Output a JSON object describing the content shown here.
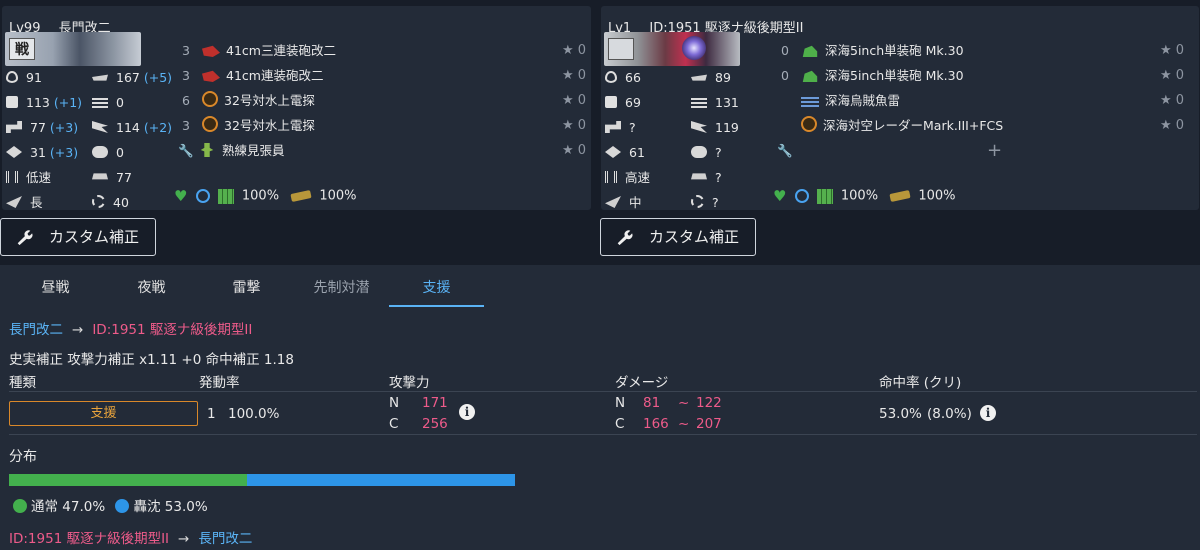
{
  "left_ship": {
    "level": "Lv99",
    "name": "長門改二",
    "type_badge": "戦",
    "stats": {
      "hp": "91",
      "speed_val": "167",
      "speed_bonus": "(+5)",
      "firepower": "113",
      "firepower_bonus": "(+1)",
      "asw": "0",
      "torpedo": "77",
      "torpedo_bonus": "(+3)",
      "aa": "114",
      "aa_bonus": "(+2)",
      "armor": "31",
      "armor_bonus": "(+3)",
      "evasion_misc": "0",
      "speed": "低速",
      "los": "77",
      "range": "長",
      "luck": "40"
    },
    "equipment": [
      {
        "slot": "3",
        "name": "41cm三連装砲改二",
        "icon": "main-gun-red",
        "star": "0"
      },
      {
        "slot": "3",
        "name": "41cm連装砲改二",
        "icon": "main-gun-red",
        "star": "0"
      },
      {
        "slot": "6",
        "name": "32号対水上電探",
        "icon": "radar",
        "star": "0"
      },
      {
        "slot": "3",
        "name": "32号対水上電探",
        "icon": "radar",
        "star": "0"
      },
      {
        "slot": "",
        "name": "熟練見張員",
        "icon": "lookout",
        "star": "0"
      }
    ],
    "morale": "100%",
    "ammo": "100%"
  },
  "right_ship": {
    "level": "Lv1",
    "name": "ID:1951 駆逐ナ級後期型II",
    "type_badge": "",
    "stats": {
      "hp": "66",
      "speed_val": "89",
      "firepower": "69",
      "asw": "131",
      "torpedo": "?",
      "aa": "119",
      "armor": "61",
      "evasion_misc": "?",
      "speed": "高速",
      "los": "?",
      "range": "中",
      "luck": "?"
    },
    "equipment": [
      {
        "slot": "0",
        "name": "深海5inch単装砲 Mk.30",
        "icon": "gun-green",
        "star": "0"
      },
      {
        "slot": "0",
        "name": "深海5inch単装砲 Mk.30",
        "icon": "gun-green",
        "star": "0"
      },
      {
        "slot": "",
        "name": "深海烏賊魚雷",
        "icon": "torpedo",
        "star": "0"
      },
      {
        "slot": "",
        "name": "深海対空レーダーMark.III+FCS",
        "icon": "radar",
        "star": "0"
      }
    ],
    "add_symbol": "+",
    "morale": "100%",
    "ammo": "100%"
  },
  "custom_button_label": "カスタム補正",
  "tabs": [
    {
      "label": "昼戦"
    },
    {
      "label": "夜戦"
    },
    {
      "label": "雷撃"
    },
    {
      "label": "先制対潜"
    },
    {
      "label": "支援"
    }
  ],
  "result": {
    "attacker": "長門改二",
    "arrow": "→",
    "defender": "ID:1951 駆逐ナ級後期型II",
    "modifier_line": "史実補正 攻撃力補正 x1.11 +0 命中補正 1.18",
    "headers": {
      "type": "種類",
      "rate": "発動率",
      "power": "攻撃力",
      "damage": "ダメージ",
      "hit": "命中率 (クリ)"
    },
    "row": {
      "type": "支援",
      "count": "1",
      "rate": "100.0%",
      "power_n_label": "N",
      "power_n": "171",
      "power_c_label": "C",
      "power_c": "256",
      "dmg_n_label": "N",
      "dmg_n_min": "81",
      "dmg_n_max": "122",
      "dmg_c_label": "C",
      "dmg_c_min": "166",
      "dmg_c_max": "207",
      "tilde": "~",
      "hit": "53.0%",
      "crit": "(8.0%)"
    },
    "distribution_label": "分布",
    "distribution": {
      "normal": 0.47,
      "sunk": 0.53
    },
    "legend": {
      "normal": "通常 47.0%",
      "sunk": "轟沈 53.0%"
    },
    "reverse_attacker": "ID:1951 駆逐ナ級後期型II",
    "reverse_defender": "長門改二"
  },
  "colors": {
    "accent": "#5ab3f5",
    "enemy": "#ee5b8a",
    "normal": "#43b04d",
    "sunk": "#2d95e8",
    "support": "#e8a33c"
  }
}
